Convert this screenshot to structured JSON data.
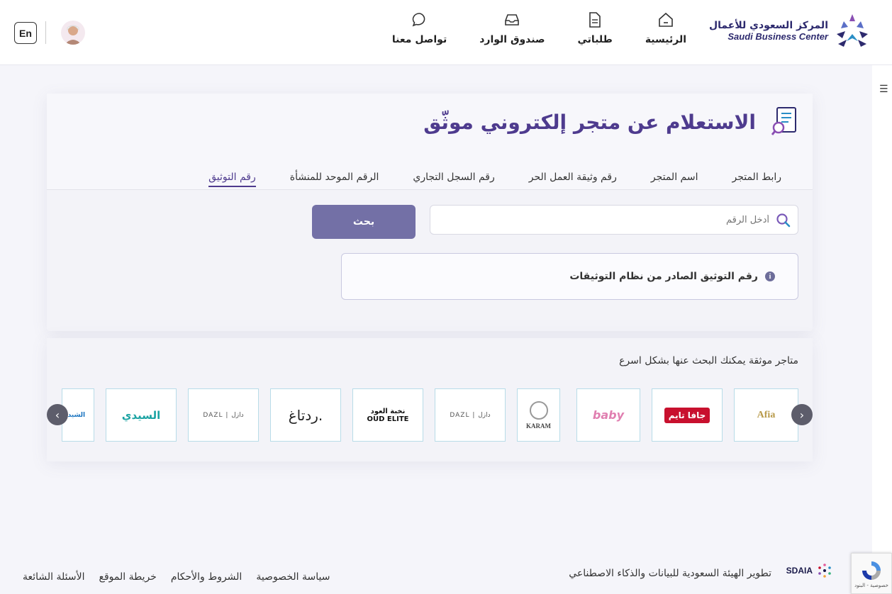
{
  "header": {
    "logo_ar": "المركز السعودي للأعمال",
    "logo_en": "Saudi Business Center",
    "nav": [
      {
        "label": "الرئيسية",
        "icon": "home-icon"
      },
      {
        "label": "طلباتي",
        "icon": "document-icon"
      },
      {
        "label": "صندوق الوارد",
        "icon": "inbox-icon"
      },
      {
        "label": "تواصل معنا",
        "icon": "chat-icon"
      }
    ],
    "lang": "En"
  },
  "main": {
    "title": "الاستعلام عن متجر إلكتروني موثّق",
    "tabs": [
      "رقم التوثيق",
      "الرقم الموحد للمنشأة",
      "رقم السجل التجاري",
      "رقم وثيقة العمل الحر",
      "اسم المتجر",
      "رابط المتجر"
    ],
    "active_tab": 0,
    "search_placeholder": "أدخل الرقم",
    "search_button": "بحث",
    "info_text": "رقم التوثيق الصادر من نظام التوثيقات"
  },
  "stores": {
    "title": "متاجر موثقة يمكنك البحث عنها بشكل اسرع",
    "items": [
      {
        "name": "Afia",
        "color": "#b89a4a"
      },
      {
        "name": "جافا تايم",
        "color": "#c8102e"
      },
      {
        "name": "baby",
        "color": "#e07fb0"
      },
      {
        "name": "KARAM",
        "color": "#444444"
      },
      {
        "name": "DAZL | دازل",
        "color": "#555555"
      },
      {
        "name": "نخبة العود OUD ELITE",
        "color": "#111111"
      },
      {
        "name": "ردتاغ.",
        "color": "#222222"
      },
      {
        "name": "DAZL | دازل",
        "color": "#555555"
      },
      {
        "name": "السيدي",
        "color": "#1ba3a3"
      },
      {
        "name": "الشيدو",
        "color": "#1a74c0"
      }
    ]
  },
  "footer": {
    "links": [
      "الأسئلة الشائعة",
      "خريطة الموقع",
      "الشروط والأحكام",
      "سياسة الخصوصية"
    ],
    "developed_by": "تطوير الهيئة السعودية للبيانات والذكاء الاصطناعي",
    "sdaia": "SDAIA",
    "recaptcha_sub": "خصوصية - البنود"
  }
}
